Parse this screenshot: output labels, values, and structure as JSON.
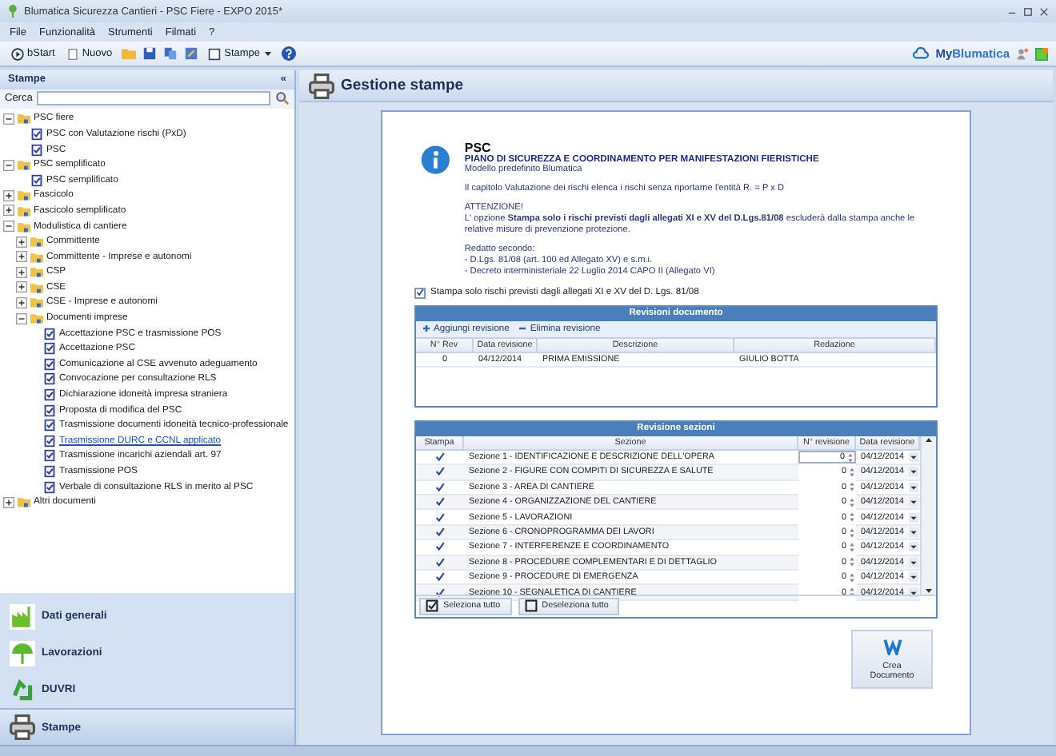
{
  "window": {
    "title": "Blumatica Sicurezza Cantieri - PSC Fiere - EXPO 2015*"
  },
  "menu": [
    "File",
    "Funzionalità",
    "Strumenti",
    "Filmati",
    "?"
  ],
  "toolbar": {
    "start": "bStart",
    "new": "Nuovo",
    "print": "Stampe",
    "brand_prefix": "My",
    "brand": "Blumatica"
  },
  "sidebar": {
    "title": "Stampe",
    "collapse": "«",
    "search_label": "Cerca",
    "tree": [
      {
        "kind": "folder",
        "label": "PSC fiere",
        "expanded": true,
        "children": [
          {
            "kind": "doc",
            "label": "PSC con Valutazione rischi (PxD)",
            "selected": false
          },
          {
            "kind": "doc",
            "label": "PSC",
            "selected": false
          }
        ]
      },
      {
        "kind": "folder",
        "label": "PSC semplificato",
        "expanded": true,
        "children": [
          {
            "kind": "doc",
            "label": "PSC semplificato",
            "selected": false
          }
        ]
      },
      {
        "kind": "folder",
        "label": "Fascicolo",
        "expanded": false
      },
      {
        "kind": "folder",
        "label": "Fascicolo semplificato",
        "expanded": false
      },
      {
        "kind": "folder",
        "label": "Modulistica di cantiere",
        "expanded": true,
        "children": [
          {
            "kind": "folder",
            "label": "Committente",
            "expanded": false
          },
          {
            "kind": "folder",
            "label": "Committente - Imprese e autonomi",
            "expanded": false
          },
          {
            "kind": "folder",
            "label": "CSP",
            "expanded": false
          },
          {
            "kind": "folder",
            "label": "CSE",
            "expanded": false
          },
          {
            "kind": "folder",
            "label": "CSE - Imprese e autonomi",
            "expanded": false
          },
          {
            "kind": "folder",
            "label": "Documenti imprese",
            "expanded": true,
            "children": [
              {
                "kind": "doc",
                "label": "Accettazione PSC e trasmissione POS",
                "selected": false
              },
              {
                "kind": "doc",
                "label": "Accettazione PSC",
                "selected": false
              },
              {
                "kind": "doc",
                "label": "Comunicazione al CSE avvenuto adeguamento",
                "selected": false
              },
              {
                "kind": "doc",
                "label": "Convocazione per consultazione RLS",
                "selected": false
              },
              {
                "kind": "doc",
                "label": "Dichiarazione idoneità impresa straniera",
                "selected": false
              },
              {
                "kind": "doc",
                "label": "Proposta di modifica del PSC",
                "selected": false
              },
              {
                "kind": "doc",
                "label": "Trasmissione documenti idoneità tecnico-professionale",
                "selected": false
              },
              {
                "kind": "doc",
                "label": "Trasmissione DURC e CCNL applicato",
                "selected": true
              },
              {
                "kind": "doc",
                "label": "Trasmissione incarichi aziendali art. 97",
                "selected": false
              },
              {
                "kind": "doc",
                "label": "Trasmissione POS",
                "selected": false
              },
              {
                "kind": "doc",
                "label": "Verbale di consultazione RLS in merito al PSC",
                "selected": false
              }
            ]
          }
        ]
      },
      {
        "kind": "folder",
        "label": "Altri documenti",
        "expanded": false
      }
    ],
    "nav": [
      {
        "label": "Dati generali",
        "kind": "factory",
        "selected": false
      },
      {
        "label": "Lavorazioni",
        "kind": "umbrella",
        "selected": false
      },
      {
        "label": "DUVRI",
        "kind": "recycle",
        "selected": false
      },
      {
        "label": "Stampe",
        "kind": "printer",
        "selected": true
      }
    ]
  },
  "main": {
    "title": "Gestione stampe",
    "doc": {
      "heading": "PSC",
      "subtitle": "PIANO DI SICUREZZA E COORDINAMENTO PER MANIFESTAZIONI FIERISTICHE",
      "model": "Modello predefinito Blumatica",
      "paragraphs": [
        "Il capitolo Valutazione dei rischi elenca i rischi senza riportarne l'entità  R. = P x D"
      ],
      "warning_title": "ATTENZIONE!",
      "warning": "L' opzione **Stampa solo i rischi previsti dagli allegati XI e XV del D.Lgs.81/08** escluderà dalla stampa anche le relative misure di prevenzione protezione.",
      "refs_title": "Redatto secondo:",
      "refs": [
        "- D.Lgs. 81/08 (art. 100 ed Allegato XV) e s.m.i.",
        "- Decreto interministeriale 22 Luglio 2014 CAPO II (Allegato VI)"
      ]
    },
    "option": {
      "label": "Stampa solo rischi previsti  dagli allegati XI e XV del D. Lgs. 81/08",
      "checked": true
    },
    "revisions": {
      "title": "Revisioni documento",
      "add": "Aggiungi revisione",
      "remove": "Elimina revisione",
      "columns": [
        "N° Rev",
        "Data revisione",
        "Descrizione",
        "Redazione"
      ],
      "rows": [
        [
          "0",
          "04/12/2014",
          "PRIMA EMISSIONE",
          "GIULIO BOTTA"
        ]
      ]
    },
    "sections": {
      "title": "Revisione sezioni",
      "columns": [
        "Stampa",
        "Sezione",
        "N° revisione",
        "Data revisione"
      ],
      "rows": [
        {
          "checked": true,
          "name": "Sezione 1 - IDENTIFICAZIONE E DESCRIZIONE DELL'OPERA",
          "rev": "0",
          "date": "04/12/2014"
        },
        {
          "checked": true,
          "name": "Sezione 2 - FIGURE CON COMPITI DI SICUREZZA E SALUTE",
          "rev": "0",
          "date": "04/12/2014"
        },
        {
          "checked": true,
          "name": "Sezione 3 - AREA DI CANTIERE",
          "rev": "0",
          "date": "04/12/2014"
        },
        {
          "checked": true,
          "name": "Sezione 4 - ORGANIZZAZIONE DEL CANTIERE",
          "rev": "0",
          "date": "04/12/2014"
        },
        {
          "checked": true,
          "name": "Sezione 5 - LAVORAZIONI",
          "rev": "0",
          "date": "04/12/2014"
        },
        {
          "checked": true,
          "name": "Sezione 6 - CRONOPROGRAMMA DEI LAVORI",
          "rev": "0",
          "date": "04/12/2014"
        },
        {
          "checked": true,
          "name": "Sezione 7 - INTERFERENZE E COORDINAMENTO",
          "rev": "0",
          "date": "04/12/2014"
        },
        {
          "checked": true,
          "name": "Sezione 8 - PROCEDURE COMPLEMENTARI E DI DETTAGLIO",
          "rev": "0",
          "date": "04/12/2014"
        },
        {
          "checked": true,
          "name": "Sezione 9 - PROCEDURE DI EMERGENZA",
          "rev": "0",
          "date": "04/12/2014"
        },
        {
          "checked": true,
          "name": "Sezione 10 - SEGNALETICA DI CANTIERE",
          "rev": "0",
          "date": "04/12/2014"
        }
      ],
      "select_all": "Seleziona tutto",
      "deselect_all": "Deseleziona tutto"
    },
    "create": "Crea Documento"
  }
}
